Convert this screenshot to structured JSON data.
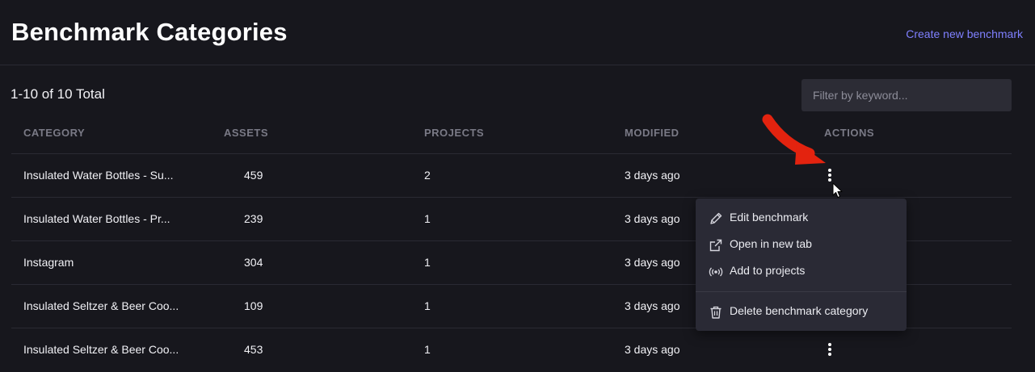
{
  "header": {
    "title": "Benchmark Categories",
    "create_link": "Create new benchmark"
  },
  "summary": {
    "total_label": "1-10 of 10 Total"
  },
  "filter": {
    "placeholder": "Filter by keyword..."
  },
  "table": {
    "columns": {
      "category": "CATEGORY",
      "assets": "ASSETS",
      "projects": "PROJECTS",
      "modified": "MODIFIED",
      "actions": "ACTIONS"
    },
    "rows": [
      {
        "category": "Insulated Water Bottles - Su...",
        "assets": "459",
        "projects": "2",
        "modified": "3 days ago"
      },
      {
        "category": "Insulated Water Bottles - Pr...",
        "assets": "239",
        "projects": "1",
        "modified": "3 days ago"
      },
      {
        "category": "Instagram",
        "assets": "304",
        "projects": "1",
        "modified": "3 days ago"
      },
      {
        "category": "Insulated Seltzer & Beer Coo...",
        "assets": "109",
        "projects": "1",
        "modified": "3 days ago"
      },
      {
        "category": "Insulated Seltzer & Beer Coo...",
        "assets": "453",
        "projects": "1",
        "modified": "3 days ago"
      }
    ]
  },
  "actions_menu": {
    "edit": "Edit benchmark",
    "open_new_tab": "Open in new tab",
    "add_to_projects": "Add to projects",
    "delete": "Delete benchmark category"
  },
  "colors": {
    "background": "#17171d",
    "accent_link": "#7f80ff",
    "annotation_arrow": "#e3230f"
  }
}
